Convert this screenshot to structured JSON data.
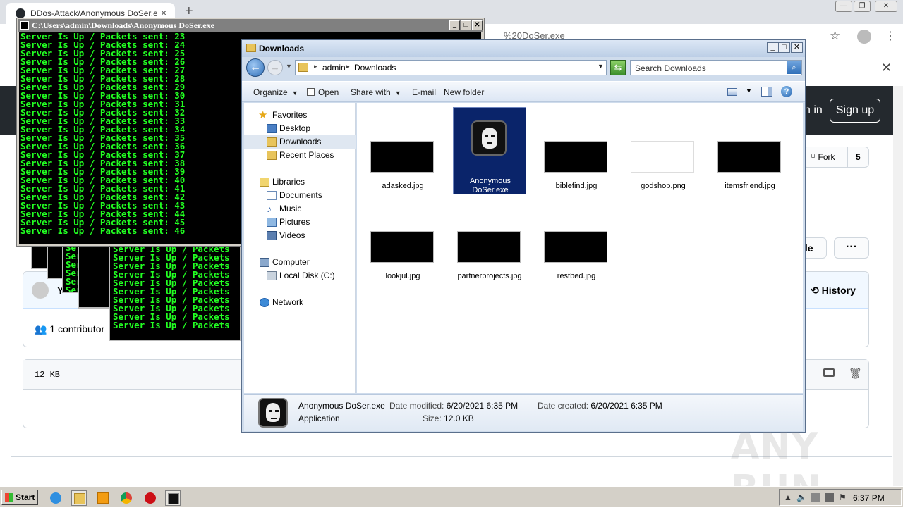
{
  "browser": {
    "tab_title": "DDos-Attack/Anonymous DoSer.exe",
    "tab_close": "×",
    "new_tab": "+",
    "url_fragment": "%20DoSer.exe",
    "window_controls": [
      "—",
      "❐",
      "✕"
    ],
    "star": "☆",
    "menu": "⋮",
    "banner_close": "✕"
  },
  "github": {
    "sign_in": "n in",
    "sign_up": "Sign up",
    "fork_label": "Fork",
    "fork_count": "5",
    "file_btn": "ile",
    "more_btn": "···",
    "commit_author_initial": "Y",
    "history": "History",
    "contributors": "1 contributor",
    "file_size": "12 KB"
  },
  "console": {
    "title": "C:\\Users\\admin\\Downloads\\Anonymous DoSer.exe",
    "lines": [
      "Server Is Up / Packets sent: 23",
      "Server Is Up / Packets sent: 24",
      "Server Is Up / Packets sent: 25",
      "Server Is Up / Packets sent: 26",
      "Server Is Up / Packets sent: 27",
      "Server Is Up / Packets sent: 28",
      "Server Is Up / Packets sent: 29",
      "Server Is Up / Packets sent: 30",
      "Server Is Up / Packets sent: 31",
      "Server Is Up / Packets sent: 32",
      "Server Is Up / Packets sent: 33",
      "Server Is Up / Packets sent: 34",
      "Server Is Up / Packets sent: 35",
      "Server Is Up / Packets sent: 36",
      "Server Is Up / Packets sent: 37",
      "Server Is Up / Packets sent: 38",
      "Server Is Up / Packets sent: 39",
      "Server Is Up / Packets sent: 40",
      "Server Is Up / Packets sent: 41",
      "Server Is Up / Packets sent: 42",
      "Server Is Up / Packets sent: 43",
      "Server Is Up / Packets sent: 44",
      "Server Is Up / Packets sent: 45",
      "Server Is Up / Packets sent: 46"
    ],
    "back_lines": [
      "Server Is Up / Packets",
      "Server Is Up / Packets",
      "Server Is Up / Packets",
      "Server Is Up / Packets",
      "Server Is Up / Packets",
      "Server Is Up / Packets",
      "Server Is Up / Packets",
      "Server Is Up / Packets",
      "Server Is Up / Packets",
      "Server Is Up / Packets"
    ],
    "snippet_a": [
      "Se",
      "Se"
    ],
    "snippet_b": [
      "Se",
      "Se",
      "Se",
      "Se"
    ],
    "snippet_c": [
      "Se",
      "Serve",
      "Serve",
      "Serve",
      "Serve",
      "Serve"
    ],
    "accent_color": "#22ff22"
  },
  "explorer": {
    "title": "Downloads",
    "breadcrumb": [
      "admin",
      "Downloads"
    ],
    "search_placeholder": "Search Downloads",
    "commands": {
      "organize": "Organize",
      "open": "Open",
      "share_with": "Share with",
      "email": "E-mail",
      "new_folder": "New folder"
    },
    "nav": {
      "favorites": "Favorites",
      "desktop": "Desktop",
      "downloads": "Downloads",
      "recent_places": "Recent Places",
      "libraries": "Libraries",
      "documents": "Documents",
      "music": "Music",
      "pictures": "Pictures",
      "videos": "Videos",
      "computer": "Computer",
      "local_disk": "Local Disk (C:)",
      "network": "Network"
    },
    "files": [
      {
        "name": "adasked.jpg"
      },
      {
        "name": "Anonymous DoSer.exe",
        "name_line1": "Anonymous",
        "name_line2": "DoSer.exe"
      },
      {
        "name": "biblefind.jpg"
      },
      {
        "name": "godshop.png"
      },
      {
        "name": "itemsfriend.jpg"
      },
      {
        "name": "lookjul.jpg"
      },
      {
        "name": "partnerprojects.jpg"
      },
      {
        "name": "restbed.jpg"
      }
    ],
    "details": {
      "name": "Anonymous DoSer.exe",
      "type": "Application",
      "modified_label": "Date modified:",
      "modified": "6/20/2021 6:35 PM",
      "created_label": "Date created:",
      "created": "6/20/2021 6:35 PM",
      "size_label": "Size:",
      "size": "12.0 KB"
    }
  },
  "taskbar": {
    "start": "Start",
    "clock": "6:37 PM"
  },
  "watermark": "ANY RUN"
}
